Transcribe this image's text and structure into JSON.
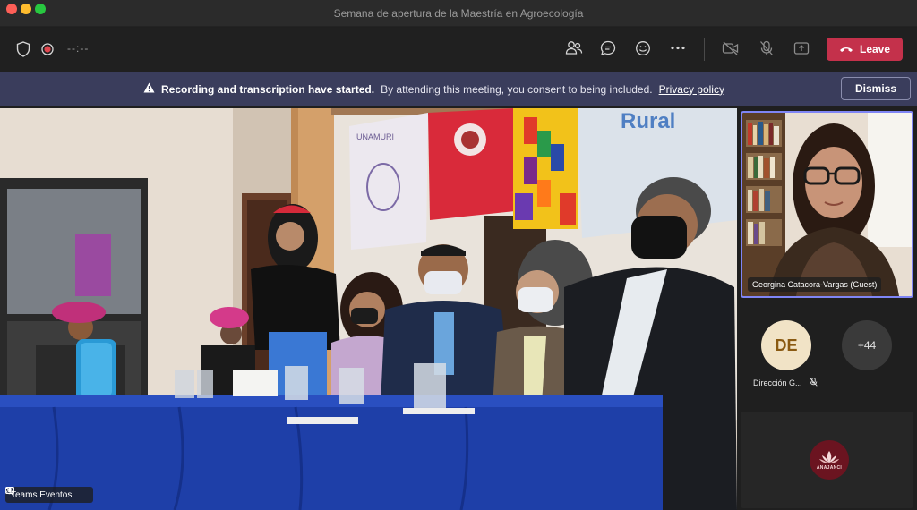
{
  "window": {
    "title": "Semana de apertura de la Maestría en Agroecología"
  },
  "toolbar": {
    "timer": "--:--",
    "leave_label": "Leave",
    "icons": [
      "shield-icon",
      "record-icon",
      "people-icon",
      "chat-icon",
      "reactions-icon",
      "more-icon",
      "camera-off-icon",
      "mic-off-icon",
      "share-icon",
      "phone-icon"
    ]
  },
  "banner": {
    "bold_text": "Recording and transcription have started.",
    "text": "By attending this meeting, you consent to being included.",
    "link": "Privacy policy",
    "dismiss_label": "Dismiss"
  },
  "main_video": {
    "name": "Teams Eventos",
    "banner_texts": [
      "UNAMURI",
      "Rural"
    ]
  },
  "participants": {
    "speaker_name": "Georgina Catacora-Vargas (Guest)",
    "de_initials": "DE",
    "de_name": "Dirección G...",
    "more_count": "+44",
    "self_logo_text": "ANAJANCI"
  },
  "colors": {
    "accent": "#7f85f5",
    "leave": "#c4314b",
    "banner": "#3a3d5c",
    "avatar_de_bg": "#f1e3c6",
    "avatar_de_fg": "#8a5a12"
  }
}
